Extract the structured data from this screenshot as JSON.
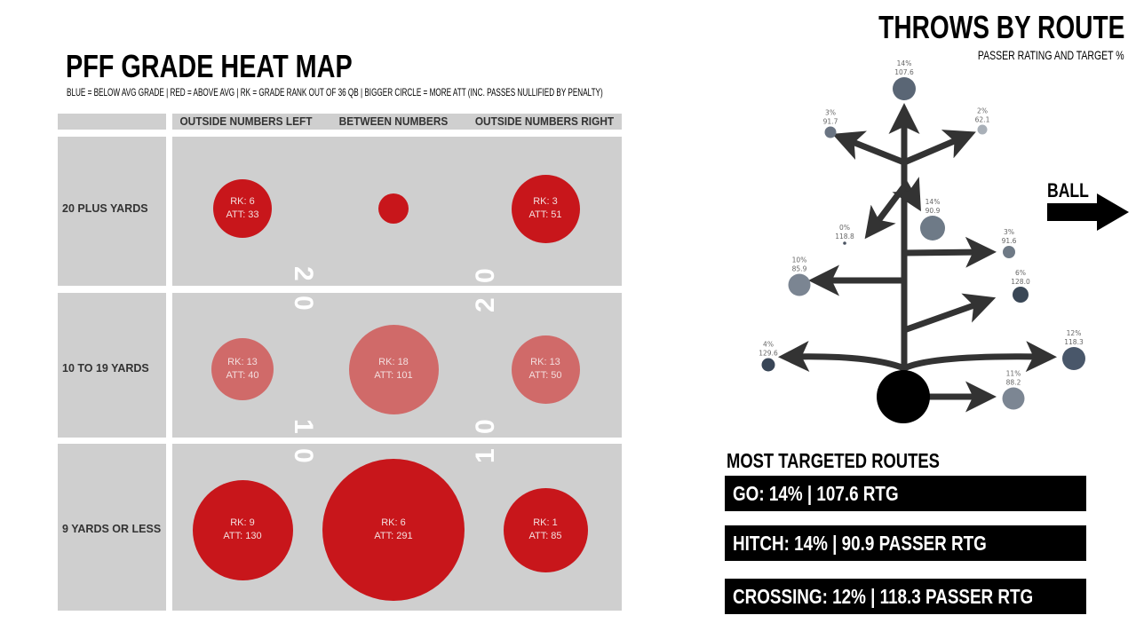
{
  "heat_map": {
    "title": "PFF GRADE HEAT MAP",
    "subtitle": "BLUE = BELOW AVG GRADE | RED = ABOVE AVG | RK = GRADE RANK OUT OF 36 QB | BIGGER CIRCLE = MORE ATT (INC. PASSES NULLIFIED BY PENALTY)",
    "columns": [
      "OUTSIDE NUMBERS LEFT",
      "BETWEEN NUMBERS",
      "OUTSIDE NUMBERS RIGHT"
    ],
    "rows": [
      {
        "label": "20 PLUS YARDS",
        "cells": [
          {
            "rk_label": "RK: 6",
            "att_label": "ATT: 33",
            "att": 33,
            "grade": "above",
            "color": "#c8161b"
          },
          {
            "rk_label": "",
            "att_label": "",
            "att": null,
            "grade": "above",
            "color": "#c8161b"
          },
          {
            "rk_label": "RK: 3",
            "att_label": "ATT: 51",
            "att": 51,
            "grade": "above",
            "color": "#c8161b"
          }
        ]
      },
      {
        "label": "10 TO 19 YARDS",
        "cells": [
          {
            "rk_label": "RK: 13",
            "att_label": "ATT: 40",
            "att": 40,
            "grade": "above",
            "color": "#d06a69"
          },
          {
            "rk_label": "RK: 18",
            "att_label": "ATT: 101",
            "att": 101,
            "grade": "above",
            "color": "#d06a69"
          },
          {
            "rk_label": "RK: 13",
            "att_label": "ATT: 50",
            "att": 50,
            "grade": "above",
            "color": "#d06a69"
          }
        ]
      },
      {
        "label": "9 YARDS OR LESS",
        "cells": [
          {
            "rk_label": "RK: 9",
            "att_label": "ATT: 130",
            "att": 130,
            "grade": "above",
            "color": "#c8161b"
          },
          {
            "rk_label": "RK: 6",
            "att_label": "ATT: 291",
            "att": 291,
            "grade": "above",
            "color": "#c8161b"
          },
          {
            "rk_label": "RK: 1",
            "att_label": "ATT: 85",
            "att": 85,
            "grade": "above",
            "color": "#c8161b"
          }
        ]
      }
    ],
    "yard_numbers": {
      "left_20": [
        "2",
        "0"
      ],
      "right_20": [
        "0",
        "2"
      ],
      "left_10": [
        "1",
        "0"
      ],
      "right_10": [
        "0",
        "1"
      ]
    }
  },
  "routes": {
    "title": "THROWS BY ROUTE",
    "subtitle": "PASSER RATING AND TARGET %",
    "ball_label": "BALL",
    "nodes": [
      {
        "route": "go",
        "pct": "14%",
        "rating": "107.6",
        "color": "#5a6675"
      },
      {
        "route": "corner-left",
        "pct": "3%",
        "rating": "91.7",
        "color": "#6a7482"
      },
      {
        "route": "corner-right",
        "pct": "2%",
        "rating": "62.1",
        "color": "#a9b0b8"
      },
      {
        "route": "hitch",
        "pct": "14%",
        "rating": "90.9",
        "color": "#6e7a87"
      },
      {
        "route": "curl-left",
        "pct": "0%",
        "rating": "118.8",
        "color": "#4a5361"
      },
      {
        "route": "out-right",
        "pct": "3%",
        "rating": "91.6",
        "color": "#6f7a86"
      },
      {
        "route": "out-left",
        "pct": "10%",
        "rating": "85.9",
        "color": "#7b8592"
      },
      {
        "route": "slant",
        "pct": "6%",
        "rating": "128.0",
        "color": "#3a4756"
      },
      {
        "route": "flat-left",
        "pct": "4%",
        "rating": "129.6",
        "color": "#394657"
      },
      {
        "route": "crossing",
        "pct": "12%",
        "rating": "118.3",
        "color": "#49576a"
      },
      {
        "route": "screen",
        "pct": "11%",
        "rating": "88.2",
        "color": "#7c8693"
      }
    ]
  },
  "most_targeted": {
    "title": "MOST TARGETED ROUTES",
    "items": [
      "GO: 14% | 107.6 RTG",
      "HITCH: 14% | 90.9 PASSER RTG",
      "CROSSING: 12% | 118.3 PASSER RTG"
    ]
  }
}
